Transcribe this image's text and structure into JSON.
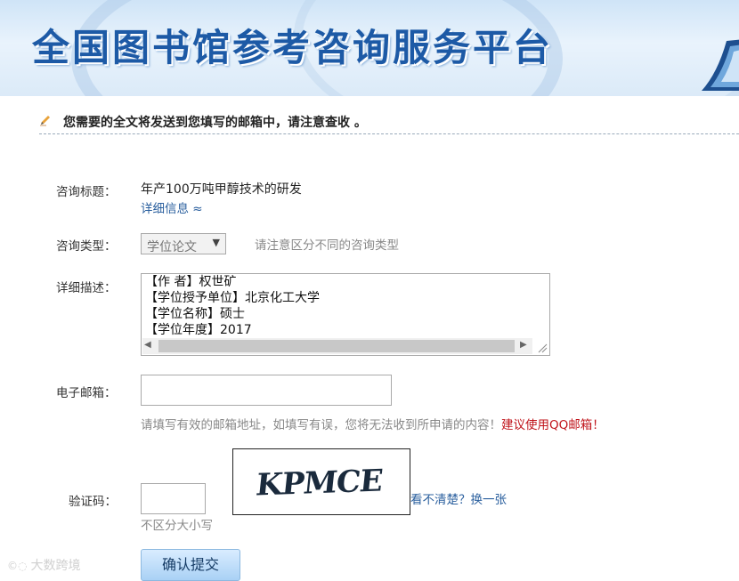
{
  "banner": {
    "title": "全国图书馆参考咨询服务平台"
  },
  "notice": {
    "text": "您需要的全文将发送到您填写的邮箱中，请注意查收 。"
  },
  "form": {
    "subject": {
      "label": "咨询标题：",
      "value": "年产100万吨甲醇技术的研发",
      "detail_link": "详细信息 ≈"
    },
    "type": {
      "label": "咨询类型：",
      "selected": "学位论文",
      "hint": "请注意区分不同的咨询类型"
    },
    "description": {
      "label": "详细描述：",
      "lines": [
        "【作 者】权世矿",
        "【学位授予单位】北京化工大学",
        "【学位名称】硕士",
        "【学位年度】2017"
      ]
    },
    "email": {
      "label": "电子邮箱：",
      "value": "",
      "hint": "请填写有效的邮箱地址，如填写有误，您将无法收到所申请的内容！",
      "hint_red": "建议使用QQ邮箱！"
    },
    "captcha": {
      "label": "验证码：",
      "value": "",
      "image_text": "KPMCE",
      "refresh_link": "看不清楚？换一张",
      "case_hint": "不区分大小写"
    },
    "submit_label": "确认提交"
  },
  "watermark": {
    "text": "大数跨境"
  }
}
